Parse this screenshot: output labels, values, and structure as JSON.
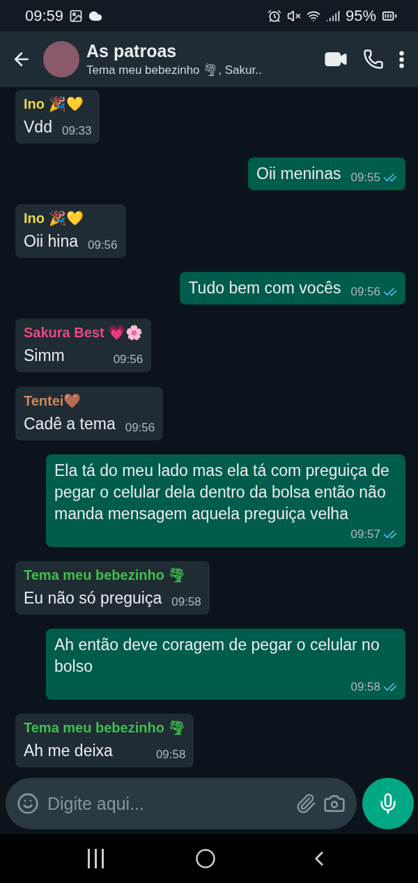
{
  "status_bar": {
    "time": "09:59",
    "battery": "95%"
  },
  "header": {
    "title": "As patroas",
    "subtitle": "Tema meu bebezinho 🌪, Sakur.."
  },
  "messages": [
    {
      "kind": "incoming",
      "sender": "Ino 🎉💛",
      "color": "#e9d84a",
      "text": "Vdd",
      "time": "09:33"
    },
    {
      "kind": "outgoing",
      "text": "Oii meninas",
      "time": "09:55",
      "read": true
    },
    {
      "kind": "incoming",
      "sender": "Ino 🎉💛",
      "color": "#e9d84a",
      "text": "Oii hina",
      "time": "09:56"
    },
    {
      "kind": "outgoing",
      "text": "Tudo bem com vocês",
      "time": "09:56",
      "read": true
    },
    {
      "kind": "incoming",
      "sender": "Sakura Best 💗🌸",
      "color": "#e8497f",
      "text": "Simm",
      "time": "09:56"
    },
    {
      "kind": "incoming",
      "sender": "Tentei🤎",
      "color": "#d0855a",
      "text": "Cadê a tema",
      "time": "09:56"
    },
    {
      "kind": "outgoing",
      "text": "Ela tá do meu lado mas ela tá com preguiça de pegar o celular dela dentro da bolsa então não manda mensagem aquela preguiça velha",
      "time": "09:57",
      "read": true
    },
    {
      "kind": "incoming",
      "sender": "Tema meu bebezinho 🌪",
      "color": "#3fbf4f",
      "text": "Eu não só preguiça",
      "time": "09:58"
    },
    {
      "kind": "outgoing",
      "text": "Ah então deve coragem de pegar o celular no bolso",
      "time": "09:58",
      "read": true
    },
    {
      "kind": "incoming",
      "sender": "Tema meu bebezinho 🌪",
      "color": "#3fbf4f",
      "text": "Ah me deixa",
      "time": "09:58"
    }
  ],
  "composer": {
    "placeholder": "Digite aqui..."
  }
}
